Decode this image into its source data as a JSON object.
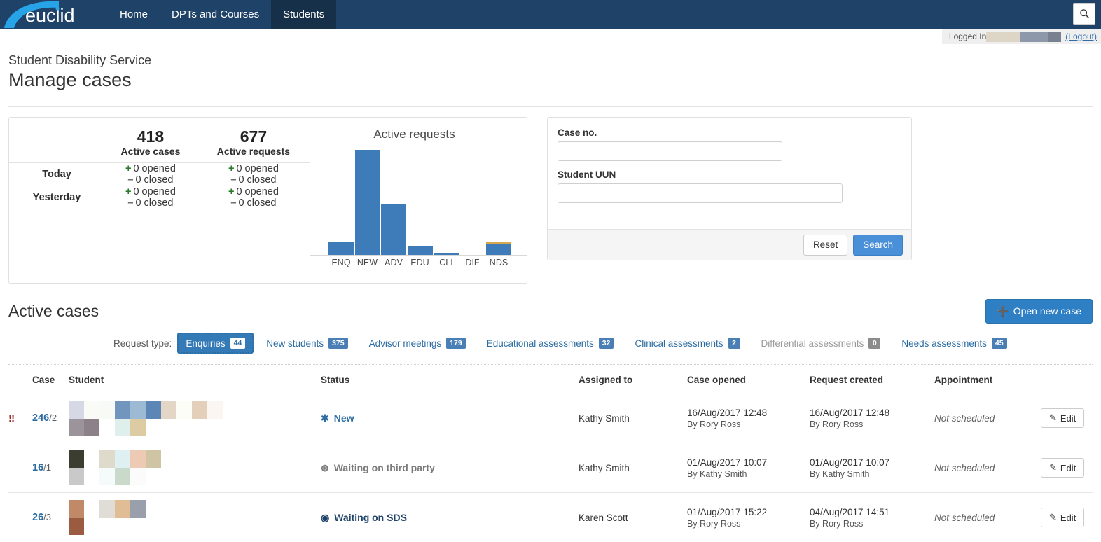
{
  "nav": {
    "brand": "euclid",
    "items": [
      {
        "label": "Home",
        "active": false
      },
      {
        "label": "DPTs and Courses",
        "active": false
      },
      {
        "label": "Students",
        "active": true
      }
    ],
    "search_icon": "search-icon"
  },
  "loginbar": {
    "logged_in_label": "Logged In",
    "logout_label": "(Logout)",
    "user_redacted": true
  },
  "page": {
    "subtitle": "Student Disability Service",
    "title": "Manage cases"
  },
  "stats": {
    "columns": [
      {
        "value": "418",
        "label": "Active cases"
      },
      {
        "value": "677",
        "label": "Active requests"
      }
    ],
    "rows": [
      {
        "label": "Today",
        "cases": [
          {
            "sign": "+",
            "text": "0 opened"
          },
          {
            "sign": "–",
            "text": "0 closed"
          }
        ],
        "requests": [
          {
            "sign": "+",
            "text": "0 opened"
          },
          {
            "sign": "–",
            "text": "0 closed"
          }
        ]
      },
      {
        "label": "Yesterday",
        "cases": [
          {
            "sign": "+",
            "text": "0 opened"
          },
          {
            "sign": "–",
            "text": "0 closed"
          }
        ],
        "requests": [
          {
            "sign": "+",
            "text": "0 opened"
          },
          {
            "sign": "–",
            "text": "0 closed"
          }
        ]
      }
    ]
  },
  "chart_data": {
    "type": "bar",
    "title": "Active requests",
    "xlabel": "",
    "ylabel": "",
    "grid": false,
    "legend": false,
    "categories": [
      "ENQ",
      "NEW",
      "ADV",
      "EDU",
      "CLI",
      "DIF",
      "NDS"
    ],
    "values": [
      44,
      375,
      179,
      32,
      2,
      0,
      45
    ],
    "ylim": [
      0,
      375
    ],
    "series": [
      {
        "name": "Requests",
        "color": "#3d7cb8",
        "values": [
          44,
          375,
          179,
          32,
          2,
          0,
          41
        ]
      },
      {
        "name": "Highlighted",
        "color": "#d8a84b",
        "values": [
          0,
          0,
          0,
          0,
          0,
          0,
          4
        ]
      }
    ]
  },
  "search_panel": {
    "case_no_label": "Case no.",
    "case_no_value": "",
    "case_no_placeholder": "",
    "uun_label": "Student UUN",
    "uun_value": "",
    "uun_placeholder": "",
    "reset_label": "Reset",
    "search_label": "Search"
  },
  "active_cases": {
    "heading": "Active cases",
    "open_new_case_label": "Open new case",
    "request_type_label": "Request type:",
    "tabs": [
      {
        "label": "Enquiries",
        "count": "44",
        "state": "active"
      },
      {
        "label": "New students",
        "count": "375",
        "state": "normal"
      },
      {
        "label": "Advisor meetings",
        "count": "179",
        "state": "normal"
      },
      {
        "label": "Educational assessments",
        "count": "32",
        "state": "normal"
      },
      {
        "label": "Clinical assessments",
        "count": "2",
        "state": "normal"
      },
      {
        "label": "Differential assessments",
        "count": "0",
        "state": "disabled"
      },
      {
        "label": "Needs assessments",
        "count": "45",
        "state": "normal"
      }
    ],
    "columns": [
      "Case",
      "Student",
      "Status",
      "Assigned to",
      "Case opened",
      "Request created",
      "Appointment"
    ],
    "edit_label": "Edit",
    "rows": [
      {
        "flag": "‼",
        "case_no": "246",
        "case_sub": "/2",
        "student_redacted": true,
        "status": "New",
        "status_icon": "asterisk-icon",
        "status_color": "#2b6ca3",
        "assigned_to": "Kathy Smith",
        "case_opened_date": "16/Aug/2017 12:48",
        "case_opened_by": "By Rory Ross",
        "request_created_date": "16/Aug/2017 12:48",
        "request_created_by": "By Rory Ross",
        "appointment": "Not scheduled"
      },
      {
        "flag": "",
        "case_no": "16",
        "case_sub": "/1",
        "student_redacted": true,
        "status": "Waiting on third party",
        "status_icon": "circle-asterisk-icon",
        "status_color": "#7a7a7a",
        "assigned_to": "Kathy Smith",
        "case_opened_date": "01/Aug/2017 10:07",
        "case_opened_by": "By Kathy Smith",
        "request_created_date": "01/Aug/2017 10:07",
        "request_created_by": "By Kathy Smith",
        "appointment": "Not scheduled"
      },
      {
        "flag": "",
        "case_no": "26",
        "case_sub": "/3",
        "student_redacted": true,
        "status": "Waiting on SDS",
        "status_icon": "dot-circle-icon",
        "status_color": "#1f4268",
        "assigned_to": "Karen Scott",
        "case_opened_date": "01/Aug/2017 15:22",
        "case_opened_by": "By Rory Ross",
        "request_created_date": "04/Aug/2017 14:51",
        "request_created_by": "By Rory Ross",
        "appointment": "Not scheduled"
      }
    ]
  },
  "colors": {
    "nav_bg": "#1f4268",
    "nav_active": "#16304a",
    "link": "#2b6ca3",
    "primary_button": "#2f7fc5",
    "bar_blue": "#3d7cb8",
    "bar_gold": "#d8a84b",
    "flag_red": "#9e2a2a",
    "green": "#2a7a2a"
  }
}
